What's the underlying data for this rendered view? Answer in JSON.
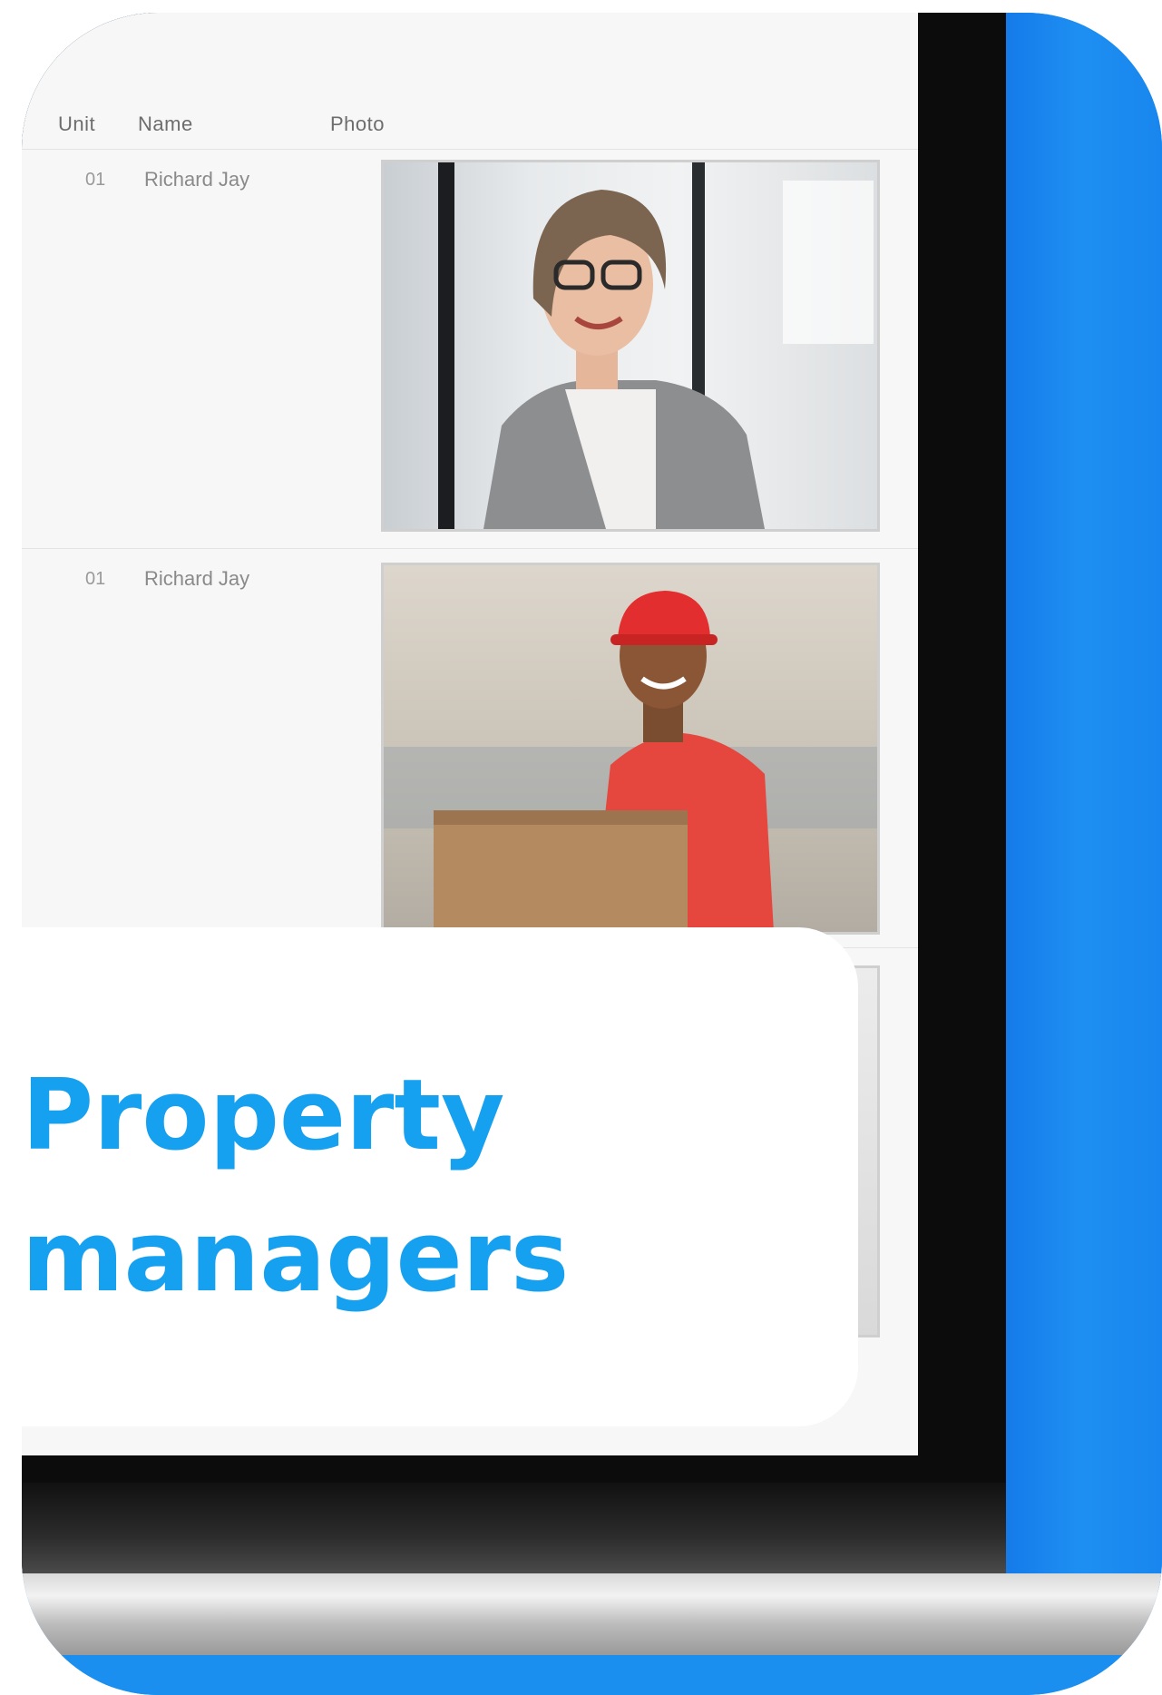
{
  "table": {
    "columns": [
      "Unit",
      "Name",
      "Photo"
    ],
    "rows": [
      {
        "unit": "01",
        "name": "Richard Jay"
      },
      {
        "unit": "01",
        "name": "Richard Jay"
      }
    ]
  },
  "headline": {
    "line1": "Property",
    "line2": "managers"
  },
  "colors": {
    "accent": "#16a0f0",
    "blue": "#1a8ff0",
    "bezel": "#0c0c0c"
  }
}
